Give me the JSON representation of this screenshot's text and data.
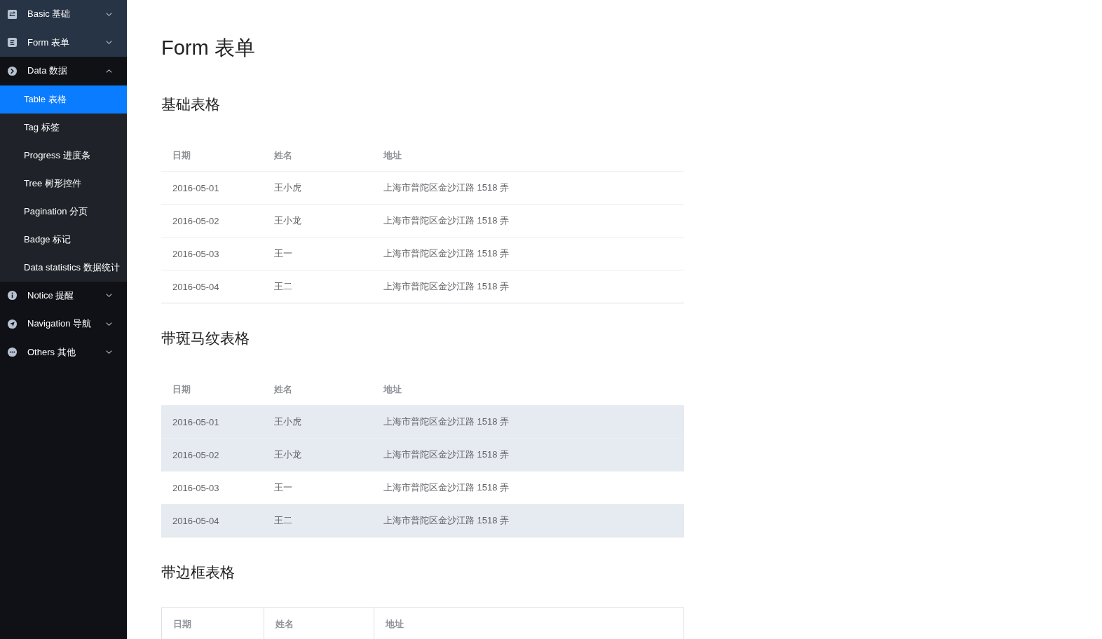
{
  "sidebar": {
    "items": [
      {
        "label": "Basic 基础",
        "expanded": false,
        "highlighted": true
      },
      {
        "label": "Form 表单",
        "expanded": false,
        "highlighted": true
      },
      {
        "label": "Data 数据",
        "expanded": true,
        "highlighted": false,
        "children": [
          {
            "label": "Table 表格",
            "selected": true
          },
          {
            "label": "Tag 标签",
            "selected": false
          },
          {
            "label": "Progress 进度条",
            "selected": false
          },
          {
            "label": "Tree 树形控件",
            "selected": false
          },
          {
            "label": "Pagination 分页",
            "selected": false
          },
          {
            "label": "Badge 标记",
            "selected": false
          },
          {
            "label": "Data statistics 数据统计",
            "selected": false
          }
        ]
      },
      {
        "label": "Notice 提醒",
        "expanded": false,
        "highlighted": false
      },
      {
        "label": "Navigation 导航",
        "expanded": false,
        "highlighted": false
      },
      {
        "label": "Others 其他",
        "expanded": false,
        "highlighted": false
      }
    ]
  },
  "page_title": "Form 表单",
  "tables": [
    {
      "kind": "plain",
      "heading": "基础表格",
      "columns": [
        "日期",
        "姓名",
        "地址"
      ],
      "rows": [
        {
          "cells": [
            "2016-05-01",
            "王小虎",
            "上海市普陀区金沙江路 1518 弄"
          ]
        },
        {
          "cells": [
            "2016-05-02",
            "王小龙",
            "上海市普陀区金沙江路 1518 弄"
          ]
        },
        {
          "cells": [
            "2016-05-03",
            "王一",
            "上海市普陀区金沙江路 1518 弄"
          ]
        },
        {
          "cells": [
            "2016-05-04",
            "王二",
            "上海市普陀区金沙江路 1518 弄"
          ]
        }
      ]
    },
    {
      "kind": "striped",
      "heading": "带斑马纹表格",
      "columns": [
        "日期",
        "姓名",
        "地址"
      ],
      "rows": [
        {
          "cells": [
            "2016-05-01",
            "王小虎",
            "上海市普陀区金沙江路 1518 弄"
          ],
          "shaded": true
        },
        {
          "cells": [
            "2016-05-02",
            "王小龙",
            "上海市普陀区金沙江路 1518 弄"
          ],
          "shaded": true
        },
        {
          "cells": [
            "2016-05-03",
            "王一",
            "上海市普陀区金沙江路 1518 弄"
          ],
          "shaded": false
        },
        {
          "cells": [
            "2016-05-04",
            "王二",
            "上海市普陀区金沙江路 1518 弄"
          ],
          "shaded": true
        }
      ]
    },
    {
      "kind": "bordered",
      "heading": "带边框表格",
      "columns": [
        "日期",
        "姓名",
        "地址"
      ]
    }
  ]
}
